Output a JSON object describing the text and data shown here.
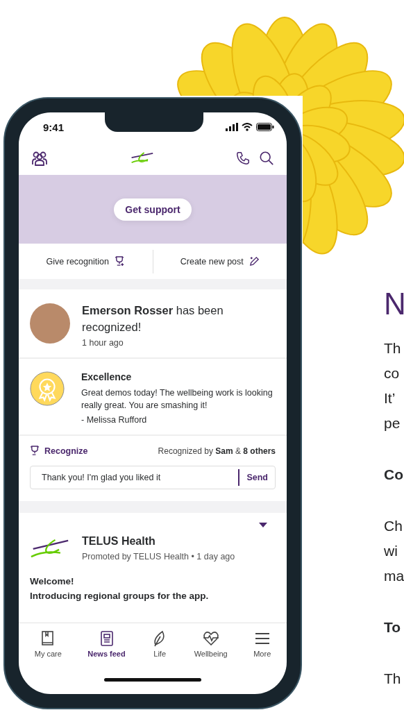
{
  "status_bar": {
    "time": "9:41"
  },
  "banner": {
    "button": "Get support"
  },
  "actions": [
    {
      "label": "Give recognition",
      "kind": "trophy"
    },
    {
      "label": "Create new post",
      "kind": "pen"
    }
  ],
  "recognition_post": {
    "headline": "**Emerson Rosser** has been recognized!",
    "time": "1 hour ago",
    "badge_title": "Excellence",
    "message": "Great demos today! The wellbeing work is looking really great. You are smashing it!",
    "author": "- Melissa Rufford",
    "recognize_button": "Recognize",
    "recognized_by": "Recognized by **Sam** & **8 others**",
    "reply": {
      "value": "Thank you! I'm glad you liked it",
      "send": "Send"
    }
  },
  "promoted_post": {
    "name": "TELUS Health",
    "meta": "Promoted by TELUS Health • 1 day ago",
    "title": "Welcome!",
    "subtitle": "Introducing regional groups for the app."
  },
  "bottom_nav": [
    {
      "label": "My care",
      "kind": "book",
      "selected": false
    },
    {
      "label": "News feed",
      "kind": "news",
      "selected": true
    },
    {
      "label": "Life",
      "kind": "leaf",
      "selected": false
    },
    {
      "label": "Wellbeing",
      "kind": "heart",
      "selected": false
    },
    {
      "label": "More",
      "kind": "menu",
      "selected": false
    }
  ],
  "article": [
    {
      "kind": "heading",
      "text": "N"
    },
    {
      "kind": "paragraph",
      "lines": [
        "Th",
        "co",
        "It’",
        "pe"
      ]
    },
    {
      "kind": "subheading",
      "text": "Co"
    },
    {
      "kind": "paragraph",
      "lines": [
        "Ch",
        "wi",
        "ma"
      ]
    },
    {
      "kind": "subheading",
      "text": "To"
    },
    {
      "kind": "paragraph",
      "lines": [
        "Th"
      ]
    }
  ]
}
